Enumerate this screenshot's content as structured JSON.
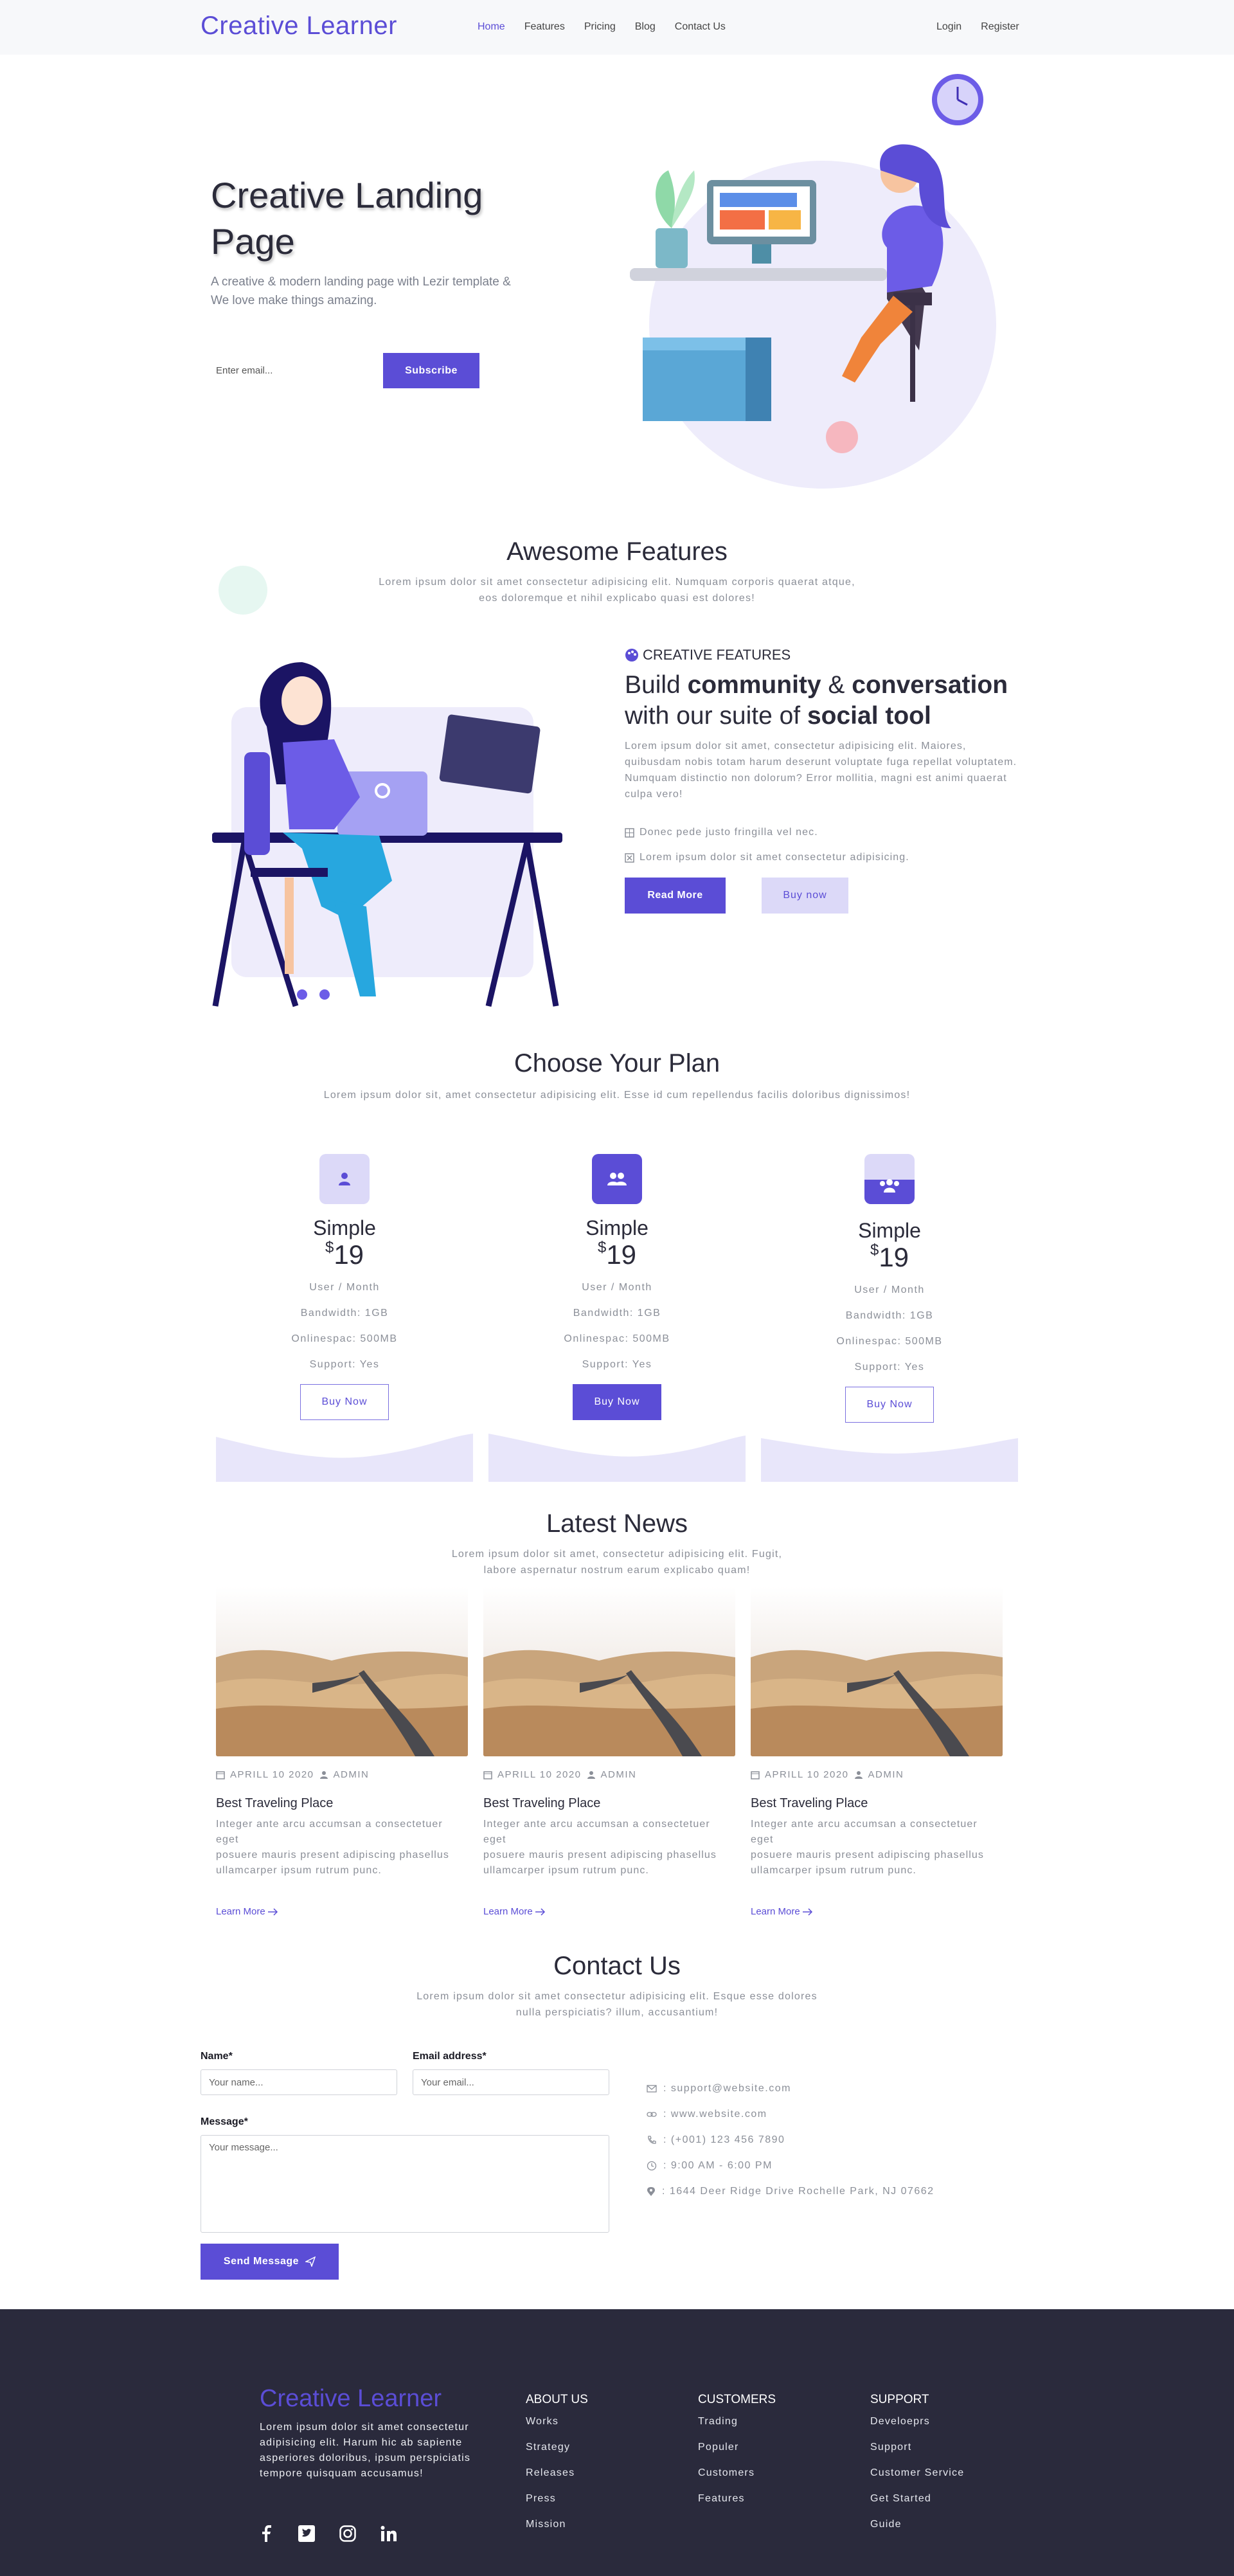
{
  "nav": {
    "brand": "Creative Learner",
    "links": [
      "Home",
      "Features",
      "Pricing",
      "Blog",
      "Contact Us"
    ],
    "login": "Login",
    "register": "Register"
  },
  "hero": {
    "title": "Creative Landing Page",
    "subtitle": "A creative & modern landing page with Lezir template & We love make things amazing.",
    "email_placeholder": "Enter email...",
    "subscribe_label": "Subscribe"
  },
  "features": {
    "title": "Awesome Features",
    "subtitle_line1": "Lorem ipsum dolor sit amet consectetur adipisicing elit. Numquam corporis quaerat atque,",
    "subtitle_line2": "eos doloremque et nihil explicabo quasi est dolores!",
    "label": "CREATIVE FEATURES",
    "heading_a": "Build ",
    "heading_b": "community",
    "heading_c": " & ",
    "heading_d": "conversation",
    "heading_e": "with our suite of ",
    "heading_f": "social tool",
    "description": "Lorem ipsum dolor sit amet, consectetur adipisicing elit. Maiores, quibusdam nobis totam harum deserunt voluptate fuga repellat voluptatem. Numquam distinctio non dolorum? Error mollitia, magni est animi quaerat culpa vero!",
    "item1": "Donec pede justo fringilla vel nec.",
    "item2": "Lorem ipsum dolor sit amet consectetur adipisicing.",
    "read_more": "Read More",
    "buy_now": "Buy now"
  },
  "pricing": {
    "title": "Choose Your Plan",
    "subtitle": "Lorem ipsum dolor sit, amet consectetur adipisicing elit. Esse id cum repellendus facilis doloribus dignissimos!",
    "plans": [
      {
        "name": "Simple",
        "currency": "$",
        "price": "19",
        "period": "User / Month",
        "bandwidth": "Bandwidth: 1GB",
        "storage": "Onlinespac: 500MB",
        "support": "Support: Yes",
        "button": "Buy Now"
      },
      {
        "name": "Simple",
        "currency": "$",
        "price": "19",
        "period": "User / Month",
        "bandwidth": "Bandwidth: 1GB",
        "storage": "Onlinespac: 500MB",
        "support": "Support: Yes",
        "button": "Buy Now"
      },
      {
        "name": "Simple",
        "currency": "$",
        "price": "19",
        "period": "User / Month",
        "bandwidth": "Bandwidth: 1GB",
        "storage": "Onlinespac: 500MB",
        "support": "Support: Yes",
        "button": "Buy Now"
      }
    ]
  },
  "news": {
    "title": "Latest News",
    "subtitle_line1": "Lorem ipsum dolor sit amet, consectetur adipisicing elit. Fugit,",
    "subtitle_line2": "labore aspernatur nostrum earum explicabo quam!",
    "posts": [
      {
        "date": "APRILL 10 2020",
        "author": "ADMIN",
        "title": "Best Traveling Place",
        "line1": "Integer ante arcu accumsan a consectetuer eget",
        "line2": "posuere mauris present adipiscing phasellus",
        "line3": "ullamcarper ipsum rutrum punc.",
        "link": "Learn More"
      },
      {
        "date": "APRILL 10 2020",
        "author": "ADMIN",
        "title": "Best Traveling Place",
        "line1": "Integer ante arcu accumsan a consectetuer eget",
        "line2": "posuere mauris present adipiscing phasellus",
        "line3": "ullamcarper ipsum rutrum punc.",
        "link": "Learn More"
      },
      {
        "date": "APRILL 10 2020",
        "author": "ADMIN",
        "title": "Best Traveling Place",
        "line1": "Integer ante arcu accumsan a consectetuer eget",
        "line2": "posuere mauris present adipiscing phasellus",
        "line3": "ullamcarper ipsum rutrum punc.",
        "link": "Learn More"
      }
    ]
  },
  "contact": {
    "title": "Contact Us",
    "subtitle_line1": "Lorem ipsum dolor sit amet consectetur adipisicing elit. Esque esse dolores",
    "subtitle_line2": "nulla perspiciatis? illum, accusantium!",
    "name_label": "Name*",
    "name_placeholder": "Your name...",
    "email_label": "Email address*",
    "email_placeholder": "Your email...",
    "message_label": "Message*",
    "message_placeholder": "Your message...",
    "send_label": "Send Message",
    "email": ": support@website.com",
    "website": ": www.website.com",
    "phone": ": (+001) 123 456 7890",
    "hours": ": 9:00 AM - 6:00 PM",
    "address": ": 1644 Deer Ridge Drive Rochelle Park, NJ 07662"
  },
  "footer": {
    "brand": "Creative Learner",
    "about": "Lorem ipsum dolor sit amet consectetur adipisicing elit. Harum hic ab sapiente asperiores doloribus, ipsum perspiciatis tempore quisquam accusamus!",
    "columns": [
      {
        "title": "ABOUT US",
        "links": [
          "Works",
          "Strategy",
          "Releases",
          "Press",
          "Mission"
        ]
      },
      {
        "title": "CUSTOMERS",
        "links": [
          "Trading",
          "Populer",
          "Customers",
          "Features"
        ]
      },
      {
        "title": "SUPPORT",
        "links": [
          "Develoeprs",
          "Support",
          "Customer Service",
          "Get Started",
          "Guide"
        ]
      }
    ]
  },
  "colors": {
    "accent": "#5b4dd6",
    "accent_light": "#dcd9f8",
    "footer_bg": "#2a2a3c",
    "text_muted": "#8b8f98"
  }
}
